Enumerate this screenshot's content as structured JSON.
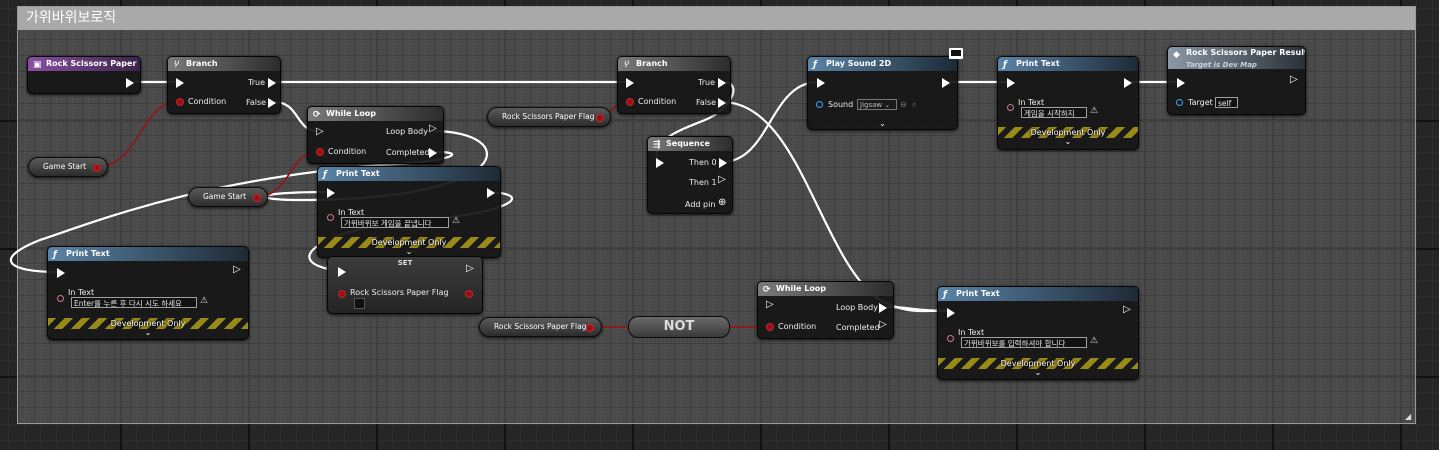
{
  "graph": {
    "comment_title": "가위바위보로직"
  },
  "nodes": {
    "event_rsp": {
      "title": "Rock Scissors Paper"
    },
    "branch1": {
      "title": "Branch",
      "condition": "Condition",
      "true": "True",
      "false": "False"
    },
    "game_start1": {
      "label": "Game Start"
    },
    "game_start2": {
      "label": "Game Start"
    },
    "while1": {
      "title": "While Loop",
      "condition": "Condition",
      "loop_body": "Loop Body",
      "completed": "Completed"
    },
    "print_end": {
      "title": "Print Text",
      "in_text": "In Text",
      "value": "가위바위보 게임을 끝냅니다",
      "dev": "Development Only"
    },
    "print_retry": {
      "title": "Print Text",
      "in_text": "In Text",
      "value": "Enter를 누른 후 다시 시도 하세요",
      "dev": "Development Only"
    },
    "set_flag": {
      "title": "SET",
      "var": "Rock Scissors Paper Flag"
    },
    "flag_var1": {
      "label": "Rock Scissors Paper Flag"
    },
    "flag_var2": {
      "label": "Rock Scissors Paper Flag"
    },
    "not_node": {
      "label": "NOT"
    },
    "branch2": {
      "title": "Branch",
      "condition": "Condition",
      "true": "True",
      "false": "False"
    },
    "sequence": {
      "title": "Sequence",
      "then0": "Then 0",
      "then1": "Then 1",
      "add_pin": "Add pin"
    },
    "play_sound": {
      "title": "Play Sound 2D",
      "sound": "Sound",
      "sound_value": "Jigsaw"
    },
    "print_start": {
      "title": "Print Text",
      "in_text": "In Text",
      "value": "게임을 시작하지",
      "dev": "Development Only"
    },
    "rsp_result": {
      "title": "Rock Scissors Paper Result",
      "subtitle": "Target is Dev Map",
      "target": "Target",
      "target_value": "self"
    },
    "while2": {
      "title": "While Loop",
      "condition": "Condition",
      "loop_body": "Loop Body",
      "completed": "Completed"
    },
    "print_input": {
      "title": "Print Text",
      "in_text": "In Text",
      "value": "가위바위보를 입력하셔야 합니다",
      "dev": "Development Only"
    }
  },
  "icons": {
    "function": "f-icon",
    "branch": "branch-icon",
    "loop": "loop-icon",
    "sequence": "sequence-icon",
    "event": "event-icon",
    "warning": "warning-icon",
    "monitor": "monitor-icon"
  },
  "colors": {
    "exec_wire": "#ffffff",
    "bool_wire": "#8c1a1a",
    "func_header": "#5a84a8",
    "event_header": "#8a4fa6",
    "dev_stripe": "#9a8a18"
  }
}
